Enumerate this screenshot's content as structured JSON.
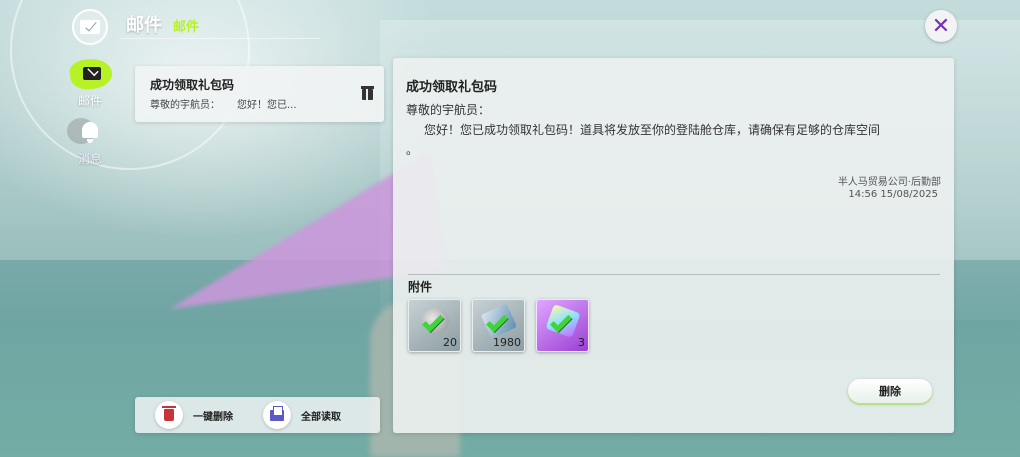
{
  "header": {
    "title": "邮件",
    "subtitle": "邮件"
  },
  "nav": {
    "items": [
      {
        "label": "邮件",
        "icon": "mail-icon",
        "active": true
      },
      {
        "label": "消息",
        "icon": "bell-icon",
        "active": false
      }
    ]
  },
  "mail_list": [
    {
      "title": "成功领取礼包码",
      "from": "尊敬的宇航员：",
      "preview": "您好！您已...",
      "icon": "gift-icon"
    }
  ],
  "actions": {
    "delete_all": "一键删除",
    "read_all": "全部读取"
  },
  "detail": {
    "title": "成功领取礼包码",
    "greeting": "尊敬的宇航员：",
    "body": "您好！您已成功领取礼包码！道具将发放至你的登陆舱仓库，请确保有足够的仓库空间 。",
    "sender": "半人马贸易公司·后勤部",
    "time": "14:56 15/08/2025",
    "attachments_label": "附件",
    "attachments": [
      {
        "qty": "20",
        "rarity": "grey",
        "claimed": true
      },
      {
        "qty": "1980",
        "rarity": "grey",
        "claimed": true
      },
      {
        "qty": "3",
        "rarity": "purple",
        "claimed": true
      }
    ],
    "delete_label": "删除"
  },
  "colors": {
    "accent_green": "#b7f226",
    "close_purple": "#7a2db5",
    "claimed_check": "#3fd43a"
  }
}
